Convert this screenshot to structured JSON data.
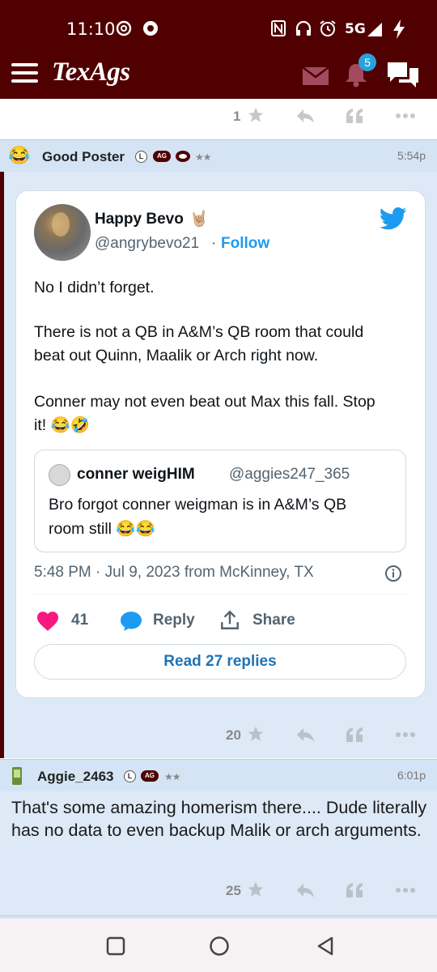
{
  "status_bar": {
    "time": "11:10",
    "network": "5G"
  },
  "header": {
    "logo": "TexAgs",
    "notification_count": "5"
  },
  "prev_post": {
    "star_count": "1"
  },
  "post1": {
    "username": "Good Poster",
    "badge_l": "L",
    "badge_ag": "AG",
    "stars": "★★",
    "time": "5:54p",
    "star_count": "20"
  },
  "tweet": {
    "display_name": "Happy Bevo",
    "emoji": "🤘🏼",
    "handle": "@angrybevo21",
    "dot": "·",
    "follow": "Follow",
    "line1": "No I didn’t forget.",
    "line2a": "There is not a QB in A&M’s QB room that could",
    "line2b": "beat out Quinn, Maalik or Arch right now.",
    "line3a": "Conner may not even beat out Max this fall. Stop",
    "line3b": "it! 😂🤣",
    "quote": {
      "name": "conner weigHIM",
      "handle": "@aggies247_365",
      "line1": "Bro forgot conner weigman is in A&M’s QB",
      "line2": "room still 😂😂"
    },
    "meta": "5:48 PM · Jul 9, 2023 from McKinney, TX",
    "likes": "41",
    "reply_label": "Reply",
    "share_label": "Share",
    "read_replies": "Read 27 replies",
    "colors": {
      "like": "#f91880",
      "link": "#1d9bf0",
      "twitter": "#1d9bf0"
    }
  },
  "post2": {
    "username": "Aggie_2463",
    "badge_l": "L",
    "badge_ag": "AG",
    "stars": "★★",
    "time": "6:01p",
    "body": "That's some amazing homerism there.... Dude literally has no data to even backup Malik or arch arguments.",
    "star_count": "25"
  },
  "theme": {
    "maroon": "#500000",
    "post_bg": "#dde9f6",
    "header_bg": "#d4e4f4"
  }
}
